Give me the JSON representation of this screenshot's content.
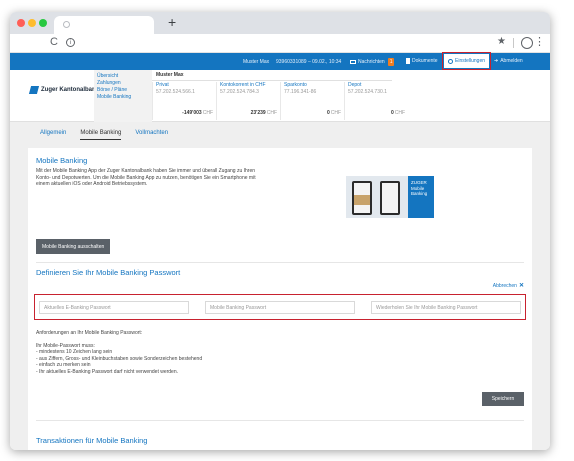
{
  "browser": {
    "new_tab_symbol": "+",
    "reload_symbol": "C",
    "info_symbol": "i",
    "star_symbol": "★",
    "menu_symbol": "⋮"
  },
  "topnav": {
    "user": "Muster Max",
    "contract_info": "93960331089 – 09.02., 10:34",
    "messages_label": "Nachrichten",
    "messages_count": "1",
    "documents_label": "Dokumente",
    "settings_label": "Einstellungen",
    "logout_label": "Abmelden"
  },
  "bank": {
    "name": "Zuger Kantonalbank"
  },
  "quick_links": [
    "Übersicht",
    "Zahlungen",
    "Börse / Pläne",
    "Mobile Banking"
  ],
  "account_owner": "Muster Max",
  "accounts": [
    {
      "name": "Privat",
      "number": "57.202.524.566.1",
      "amount": "-149'003",
      "currency": "CHF"
    },
    {
      "name": "Kontokorrent in CHF",
      "number": "57.202.524.784.3",
      "amount": "23'239",
      "currency": "CHF"
    },
    {
      "name": "Sparkonto",
      "number": "77.196.341-86",
      "amount": "0",
      "currency": "CHF"
    },
    {
      "name": "Depot",
      "number": "57.202.524.730.1",
      "amount": "0",
      "currency": "CHF"
    }
  ],
  "subtabs": [
    "Allgemein",
    "Mobile Banking",
    "Vollmachten"
  ],
  "mobile_banking": {
    "title": "Mobile Banking",
    "description_lines": [
      "Mit der Mobile Banking App der Zuger Kantonalbank haben Sie immer und überall Zugang zu Ihren",
      "Konto- und Depotwerten. Um die Mobile Banking App zu nutzen, benötigen Sie ein Smartphone mit",
      "einem aktuellen iOS oder Android Betriebssystem."
    ],
    "promo_brand": "ZUGER",
    "promo_lines": [
      "Mobile",
      "Banking"
    ],
    "button_label": "Mobile Banking ausschalten"
  },
  "password_section": {
    "title": "Definieren Sie Ihr Mobile Banking Passwort",
    "cancel_label": "Abbrechen",
    "cancel_symbol": "✕",
    "placeholders": [
      "Aktuelles E-Banking Passwort",
      "Mobile Banking Passwort",
      "Wiederholen Sie Ihr Mobile Banking Passwort"
    ],
    "requirements_title": "Anforderungen an Ihr Mobile Banking Passwort:",
    "requirements_intro": "Ihr Mobile-Passwort muss:",
    "requirements": [
      "- mindestens 10 Zeichen lang sein",
      "- aus Ziffern, Gross- und Kleinbuchstaben sowie Sonderzeichen bestehend",
      "- einfach zu merken sein",
      "- Ihr aktuelles E-Banking Passwort darf nicht verwendet werden."
    ],
    "save_label": "Speichern"
  },
  "transactions": {
    "title": "Transaktionen für Mobile Banking"
  },
  "colors": {
    "brand_blue": "#1475c0",
    "highlight_red": "#c8222f",
    "button_gray": "#5a6168"
  }
}
